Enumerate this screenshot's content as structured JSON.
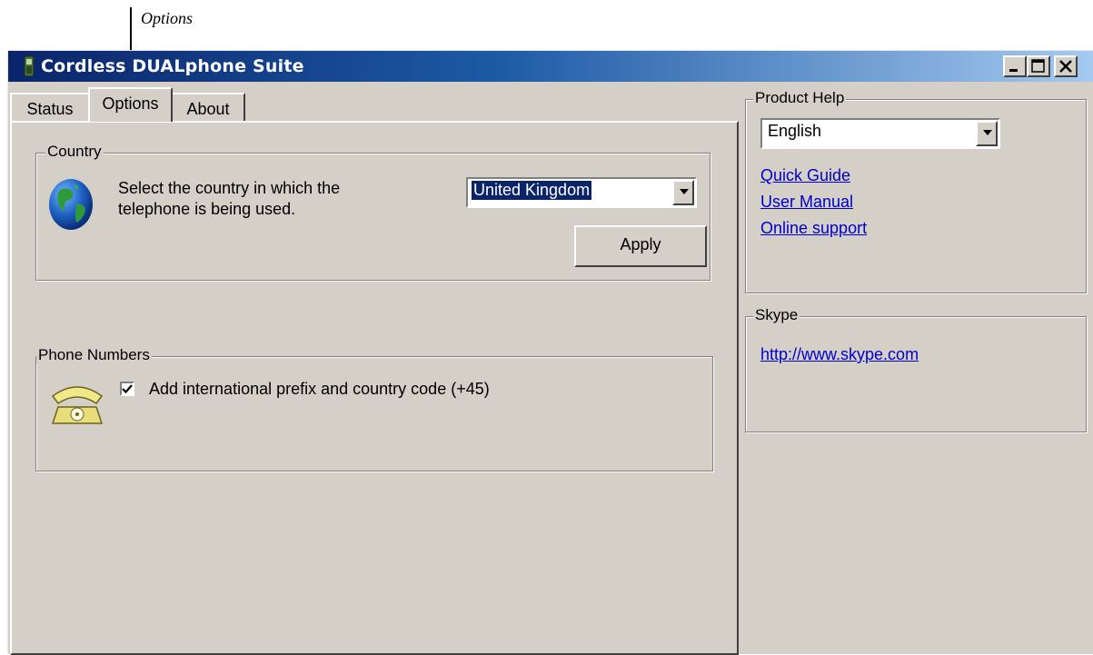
{
  "callout": {
    "label": "Options"
  },
  "window": {
    "title": "Cordless DUALphone Suite",
    "controls": {
      "minimize": "_",
      "maximize": "□",
      "close": "×"
    }
  },
  "tabs": [
    {
      "label": "Status",
      "active": false
    },
    {
      "label": "Options",
      "active": true
    },
    {
      "label": "About",
      "active": false
    }
  ],
  "country": {
    "group_label": "Country",
    "description_line1": "Select the country in which the",
    "description_line2": "telephone is being used.",
    "selected_country": "United Kingdom",
    "apply_label": "Apply",
    "icon": "globe-icon"
  },
  "phone_numbers": {
    "group_label": "Phone Numbers",
    "checkbox_label": "Add international prefix and country code (+45)",
    "checked": true,
    "icon": "telephone-icon"
  },
  "product_help": {
    "group_label": "Product Help",
    "language": "English",
    "links": [
      "Quick Guide",
      "User Manual",
      "Online support"
    ]
  },
  "skype": {
    "group_label": "Skype",
    "link": "http://www.skype.com"
  },
  "colors": {
    "title_gradient_start": "#0a246a",
    "title_gradient_end": "#a6caf0",
    "face": "#d4d0c8",
    "link": "#0000cc",
    "selection": "#0a246a"
  }
}
